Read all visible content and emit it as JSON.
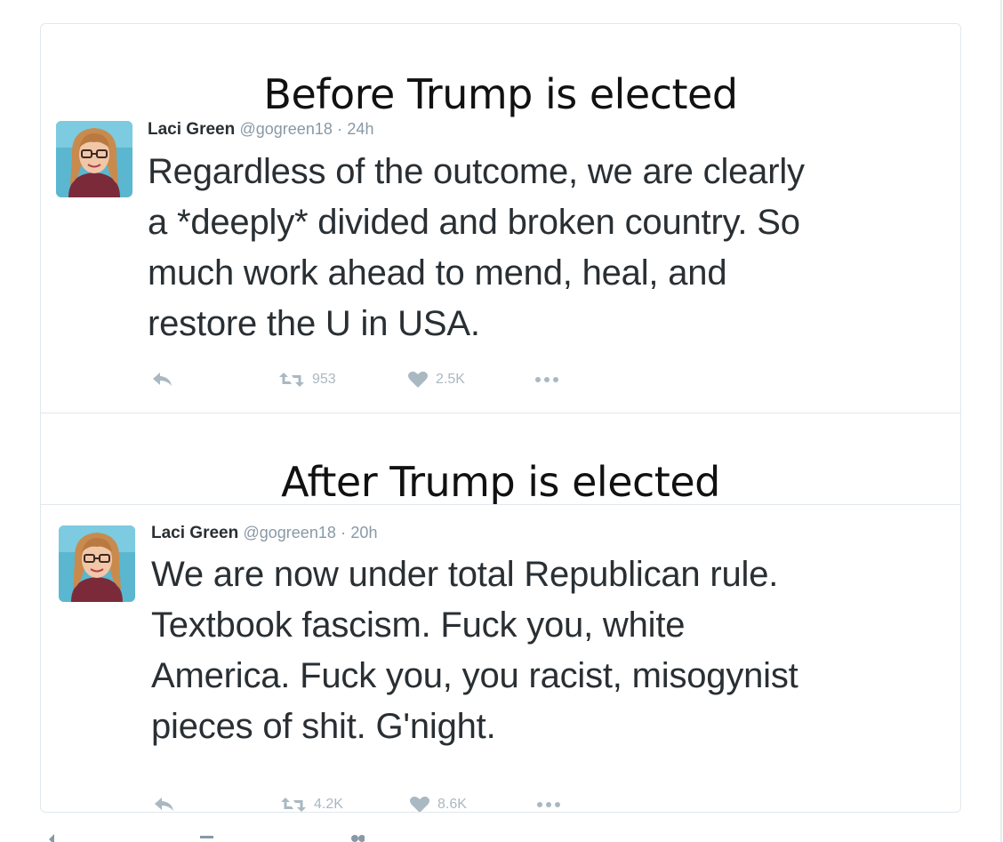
{
  "captions": {
    "before": "Before Trump is elected",
    "after": "After Trump is elected"
  },
  "tweets": [
    {
      "name": "Laci Green",
      "handle": "@gogreen18",
      "separator": "·",
      "time": "24h",
      "text_lines": [
        "Regardless of the outcome, we are clearly",
        "a *deeply* divided and broken country. So",
        "much work ahead to mend, heal, and",
        "restore the U in USA."
      ],
      "retweets": "953",
      "likes": "2.5K",
      "icons": [
        "reply-icon",
        "retweet-icon",
        "heart-icon",
        "more-icon"
      ]
    },
    {
      "name": "Laci Green",
      "handle": "@gogreen18",
      "separator": "·",
      "time": "20h",
      "text_lines": [
        "We are now under total Republican rule.",
        "Textbook fascism. Fuck you, white",
        "America. Fuck you, you racist, misogynist",
        "pieces of shit. G'night."
      ],
      "retweets": "4.2K",
      "likes": "8.6K",
      "icons": [
        "reply-icon",
        "retweet-icon",
        "heart-icon",
        "more-icon"
      ]
    }
  ],
  "colors": {
    "text": "#292f33",
    "muted": "#8899a6",
    "action": "#aab8c2",
    "border": "#e1e8ed"
  }
}
